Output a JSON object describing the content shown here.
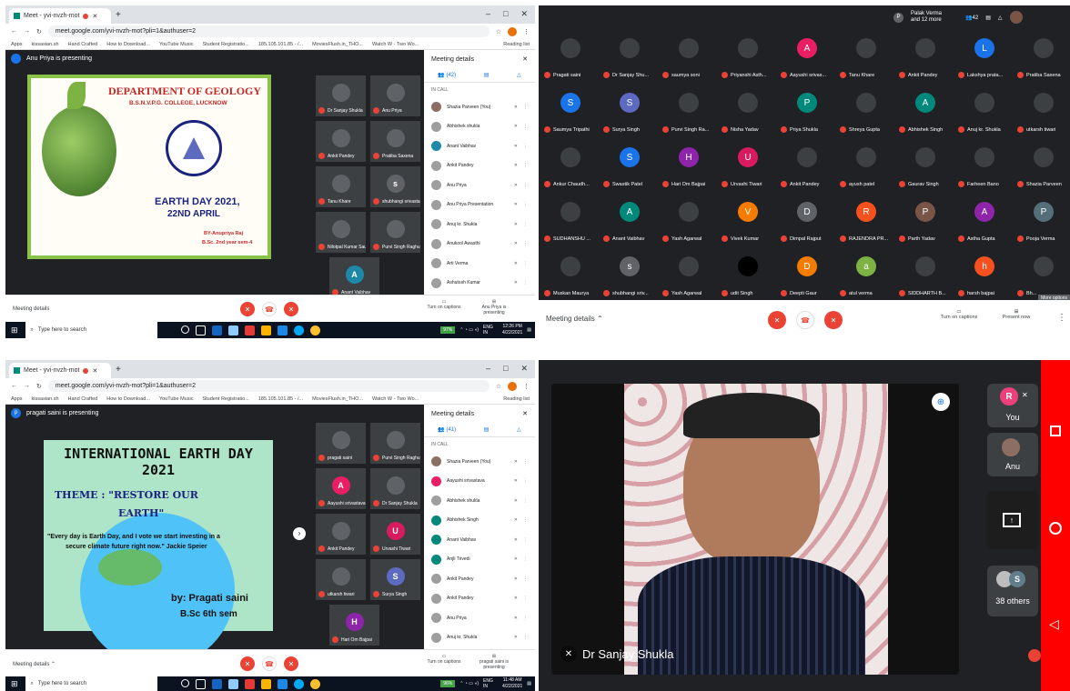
{
  "browser": {
    "tab_title": "Meet - yvi-nvzh-mot",
    "url_q1": "meet.google.com/yvi-nvzh-mot?pli=1&authuser=2",
    "url_q3": "meet.google.com/yvi-nvzh-mot?pli=1&authuser=2",
    "bookmarks": [
      "Apps",
      "kissasian.sh",
      "Hand Crafted",
      "How to Download...",
      "YouTube Music",
      "Student Registratio...",
      "185.105.101.85 - /...",
      "MoviesFlush.in_THO...",
      "Watch W - Two Wo..."
    ],
    "reading_list": "Reading list"
  },
  "q1": {
    "presenter_initial": "",
    "presenting_text": "Anu Priya is presenting",
    "slide": {
      "title": "DEPARTMENT OF GEOLOGY",
      "subtitle": "B.S.N.V.P.G. COLLEGE, LUCKNOW",
      "event": "EARTH DAY 2021,",
      "date": "22ND APRIL",
      "by": "BY-Anupriya Raj",
      "class": "B.Sc. 2nd year sem-4"
    },
    "tiles": [
      {
        "name": "Dr Sanjay Shukla",
        "initial": "",
        "color": "#5f6368"
      },
      {
        "name": "Anu Priya",
        "initial": "",
        "color": "#5f6368"
      },
      {
        "name": "Ankit Pandey",
        "initial": "",
        "color": "#5f6368"
      },
      {
        "name": "Pratiba Saxena",
        "initial": "",
        "color": "#5f6368"
      },
      {
        "name": "Tanu Khare",
        "initial": "",
        "color": "#5f6368"
      },
      {
        "name": "shubhangi srivasta...",
        "initial": "s",
        "color": "#5f6368"
      },
      {
        "name": "Nilotpal Kumar Sau...",
        "initial": "",
        "color": "#5f6368"
      },
      {
        "name": "Purvi Singh Raghun...",
        "initial": "",
        "color": "#5f6368"
      },
      {
        "name": "Anant Vaibhav",
        "initial": "A",
        "color": "#1e88a8"
      }
    ],
    "panel": {
      "title": "Meeting details",
      "count": "(42)",
      "in_call": "IN CALL",
      "people": [
        {
          "name": "Shazia Parveen (You)",
          "color": "#8d6e63"
        },
        {
          "name": "Abhishek shukla",
          "color": "#9e9e9e"
        },
        {
          "name": "Anant Vaibhav",
          "color": "#1e88a8"
        },
        {
          "name": "Ankit Pandey",
          "color": "#9e9e9e"
        },
        {
          "name": "Anu Priya",
          "color": "#9e9e9e"
        },
        {
          "name": "Anu Priya Presentation",
          "color": "#9e9e9e"
        },
        {
          "name": "Anuj kr. Shukla",
          "color": "#9e9e9e"
        },
        {
          "name": "Anukool Awasthi",
          "color": "#9e9e9e"
        },
        {
          "name": "Arti Verma",
          "color": "#9e9e9e"
        },
        {
          "name": "Ashutosh Kumar",
          "color": "#9e9e9e"
        }
      ]
    },
    "meeting_details": "Meeting details",
    "captions": "Turn on captions",
    "presenting_btn": "Anu Priya is presenting",
    "taskbar_search": "Type here to search",
    "battery": "97%",
    "lang": "ENG IN",
    "time": "12:26 PM",
    "date": "4/22/2021"
  },
  "q2": {
    "top_user": "Palak Verma",
    "top_user_sub": "and 12 more",
    "top_count": "42",
    "grid": [
      {
        "name": "Pragati saini",
        "initial": "",
        "color": "#3c4043"
      },
      {
        "name": "Dr Sanjay Shu...",
        "initial": "",
        "color": "#3c4043"
      },
      {
        "name": "saumya soni",
        "initial": "",
        "color": "#3c4043"
      },
      {
        "name": "Priyanshi Asth...",
        "initial": "",
        "color": "#3c4043"
      },
      {
        "name": "Aayushi srivas...",
        "initial": "A",
        "color": "#e91e63"
      },
      {
        "name": "Tanu Khare",
        "initial": "",
        "color": "#3c4043"
      },
      {
        "name": "Ankit Pandey",
        "initial": "",
        "color": "#3c4043"
      },
      {
        "name": "Lakshya prata...",
        "initial": "L",
        "color": "#1a73e8"
      },
      {
        "name": "Pratiba Saxena",
        "initial": "",
        "color": "#3c4043"
      },
      {
        "name": "Saumya Tripathi",
        "initial": "S",
        "color": "#1a73e8"
      },
      {
        "name": "Surya Singh",
        "initial": "S",
        "color": "#5c6bc0"
      },
      {
        "name": "Purvi Singh Ra...",
        "initial": "",
        "color": "#3c4043"
      },
      {
        "name": "Nisha Yadav",
        "initial": "",
        "color": "#3c4043"
      },
      {
        "name": "Priya Shukla",
        "initial": "P",
        "color": "#00897b"
      },
      {
        "name": "Shreya Gupta",
        "initial": "",
        "color": "#3c4043"
      },
      {
        "name": "Abhishek Singh",
        "initial": "A",
        "color": "#00897b"
      },
      {
        "name": "Anuj kr. Shukla",
        "initial": "",
        "color": "#3c4043"
      },
      {
        "name": "utkarsh tiwari",
        "initial": "",
        "color": "#3c4043"
      },
      {
        "name": "Ankur Chaudh...",
        "initial": "",
        "color": "#3c4043"
      },
      {
        "name": "Swastik Patel",
        "initial": "S",
        "color": "#1a73e8"
      },
      {
        "name": "Hari Om Bajpai",
        "initial": "H",
        "color": "#8e24aa"
      },
      {
        "name": "Urvashi Tiwari",
        "initial": "U",
        "color": "#d81b60"
      },
      {
        "name": "Ankit Pandey",
        "initial": "",
        "color": "#3c4043"
      },
      {
        "name": "ayush patel",
        "initial": "",
        "color": "#3c4043"
      },
      {
        "name": "Gaurav Singh",
        "initial": "",
        "color": "#3c4043"
      },
      {
        "name": "Farheen Bano",
        "initial": "",
        "color": "#3c4043"
      },
      {
        "name": "Shazia Parveen",
        "initial": "",
        "color": "#3c4043"
      },
      {
        "name": "SUDHANSHU ...",
        "initial": "",
        "color": "#3c4043"
      },
      {
        "name": "Anant Vaibhav",
        "initial": "A",
        "color": "#00897b"
      },
      {
        "name": "Yash Agarwal",
        "initial": "",
        "color": "#3c4043"
      },
      {
        "name": "Vivek Kumar",
        "initial": "V",
        "color": "#f57c00"
      },
      {
        "name": "Dimpal Rajput",
        "initial": "D",
        "color": "#5f6368"
      },
      {
        "name": "RAJENDRA PR...",
        "initial": "R",
        "color": "#f4511e"
      },
      {
        "name": "Parth Yadav",
        "initial": "P",
        "color": "#795548"
      },
      {
        "name": "Astha Gupta",
        "initial": "A",
        "color": "#8e24aa"
      },
      {
        "name": "Pooja Verma",
        "initial": "P",
        "color": "#546e7a"
      },
      {
        "name": "Muskan Maurya",
        "initial": "",
        "color": "#3c4043"
      },
      {
        "name": "shubhangi sriv...",
        "initial": "s",
        "color": "#5f6368"
      },
      {
        "name": "Yash Agarwal",
        "initial": "",
        "color": "#3c4043"
      },
      {
        "name": "udit Singh",
        "initial": "",
        "color": "#000000"
      },
      {
        "name": "Deepti Gaur",
        "initial": "D",
        "color": "#f57c00"
      },
      {
        "name": "atul verma",
        "initial": "a",
        "color": "#7cb342"
      },
      {
        "name": "SIDDHARTH B...",
        "initial": "",
        "color": "#3c4043"
      },
      {
        "name": "harsh bajpai",
        "initial": "h",
        "color": "#f4511e"
      },
      {
        "name": "Bh...",
        "initial": "",
        "color": "#3c4043"
      }
    ],
    "more_options": "More options",
    "meeting_details": "Meeting details",
    "captions": "Turn on captions",
    "present": "Present now"
  },
  "q3": {
    "presenter_initial": "p",
    "presenting_text": "pragati saini is presenting",
    "slide": {
      "title": "INTERNATIONAL EARTH DAY",
      "year": "2021",
      "theme": "THEME : \"RESTORE OUR",
      "theme2": "EARTH\"",
      "quote": "\"Every day is Earth Day, and I vote we start investing in a",
      "quote2": "secure climate future right now.\" Jackie Speier",
      "by": "by: Pragati saini",
      "class": "B.Sc 6th sem"
    },
    "tiles": [
      {
        "name": "pragati saini",
        "initial": "",
        "color": "#5f6368"
      },
      {
        "name": "Purvi Singh Raghun...",
        "initial": "",
        "color": "#5f6368"
      },
      {
        "name": "Aayushi srivastava",
        "initial": "A",
        "color": "#e91e63"
      },
      {
        "name": "Dr Sanjay Shukla",
        "initial": "",
        "color": "#5f6368"
      },
      {
        "name": "Ankit Pandey",
        "initial": "",
        "color": "#5f6368"
      },
      {
        "name": "Urvashi Tiwari",
        "initial": "U",
        "color": "#d81b60"
      },
      {
        "name": "utkarsh tiwari",
        "initial": "",
        "color": "#5f6368"
      },
      {
        "name": "Surya Singh",
        "initial": "S",
        "color": "#5c6bc0"
      },
      {
        "name": "Hari Om Bajpai",
        "initial": "H",
        "color": "#8e24aa"
      }
    ],
    "panel": {
      "title": "Meeting details",
      "count": "(41)",
      "in_call": "IN CALL",
      "people": [
        {
          "name": "Shazia Parveen (You)",
          "color": "#8d6e63"
        },
        {
          "name": "Aayushi srivastava",
          "color": "#e91e63"
        },
        {
          "name": "Abhishek shukla",
          "color": "#9e9e9e"
        },
        {
          "name": "Abhishek Singh",
          "color": "#00897b"
        },
        {
          "name": "Anant Vaibhav",
          "color": "#00897b"
        },
        {
          "name": "Anjli Trivedi",
          "color": "#00897b"
        },
        {
          "name": "Ankit Pandey",
          "color": "#9e9e9e"
        },
        {
          "name": "Ankit Pandey",
          "color": "#9e9e9e"
        },
        {
          "name": "Anu Priya",
          "color": "#9e9e9e"
        },
        {
          "name": "Anuj kr. Shukla",
          "color": "#9e9e9e"
        }
      ]
    },
    "meeting_details": "Meeting details",
    "captions": "Turn on captions",
    "presenting_btn": "pragati saini is presenting",
    "taskbar_search": "Type here to search",
    "battery": "96%",
    "lang": "ENG IN",
    "time": "11:48 AM",
    "date": "4/22/2021"
  },
  "q4": {
    "speaker": "Dr Sanjay Shukla",
    "you_initial": "R",
    "you_label": "You",
    "anu_label": "Anu",
    "others_initial": "S",
    "others_label": "38 others"
  }
}
